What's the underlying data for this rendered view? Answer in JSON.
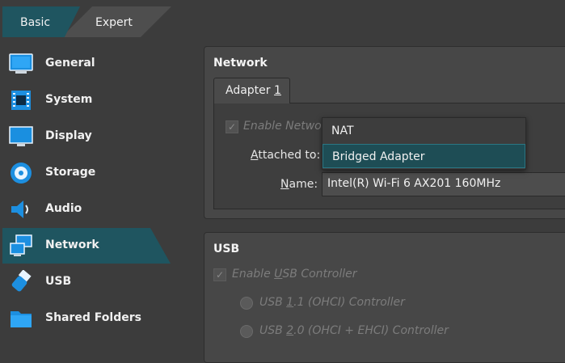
{
  "mode_tabs": {
    "basic": "Basic",
    "expert": "Expert"
  },
  "sidebar": {
    "items": [
      {
        "label": "General",
        "icon": "general-icon"
      },
      {
        "label": "System",
        "icon": "system-icon"
      },
      {
        "label": "Display",
        "icon": "display-icon"
      },
      {
        "label": "Storage",
        "icon": "storage-icon"
      },
      {
        "label": "Audio",
        "icon": "audio-icon"
      },
      {
        "label": "Network",
        "icon": "network-icon",
        "active": true
      },
      {
        "label": "USB",
        "icon": "usb-icon"
      },
      {
        "label": "Shared Folders",
        "icon": "shared-folders-icon"
      }
    ]
  },
  "network": {
    "title": "Network",
    "tab_label_prefix": "Adapter ",
    "tab_label_number": "1",
    "enable_prefix": "Enable Netwo",
    "attached_label_prefix": "A",
    "attached_label_rest": "ttached to:",
    "name_label_prefix": "N",
    "name_label_rest": "ame:",
    "name_value": "Intel(R) Wi-Fi 6 AX201 160MHz",
    "dropdown_options": [
      "NAT",
      "Bridged Adapter"
    ],
    "selected_option": "Bridged Adapter"
  },
  "usb": {
    "title": "USB",
    "enable_prefix": "Enable ",
    "enable_u": "U",
    "enable_rest": "SB Controller",
    "usb11_prefix": "USB ",
    "usb11_u": "1",
    "usb11_rest": ".1 (OHCI) Controller",
    "usb20_prefix": "USB ",
    "usb20_u": "2",
    "usb20_rest": ".0 (OHCI + EHCI) Controller"
  },
  "colors": {
    "accent": "#1f5560",
    "background": "#3c3c3c",
    "panel": "#474747"
  }
}
